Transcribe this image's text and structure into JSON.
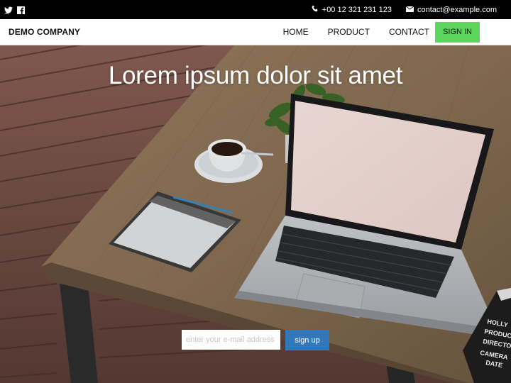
{
  "topbar": {
    "social": [
      {
        "icon": "twitter-icon"
      },
      {
        "icon": "facebook-icon"
      }
    ],
    "phone_icon": "phone-icon",
    "phone": "+00 12 321 231 123",
    "email_icon": "envelope-icon",
    "email": "contact@example.com"
  },
  "navbar": {
    "brand": "DEMO COMPANY",
    "items": [
      {
        "label": "HOME"
      },
      {
        "label": "PRODUCT"
      },
      {
        "label": "CONTACT"
      }
    ],
    "signin": "SIGN IN",
    "signin_color": "#5cd65c"
  },
  "hero": {
    "headline": "Lorem ipsum dolor sit amet",
    "email_placeholder": "enter your e-mail address",
    "signup_label": "sign up",
    "signup_color": "#3377bb",
    "clapper_lines": [
      "HOLLY",
      "PRODUC",
      "DIRECTO",
      "CAMERA",
      "DATE"
    ]
  }
}
